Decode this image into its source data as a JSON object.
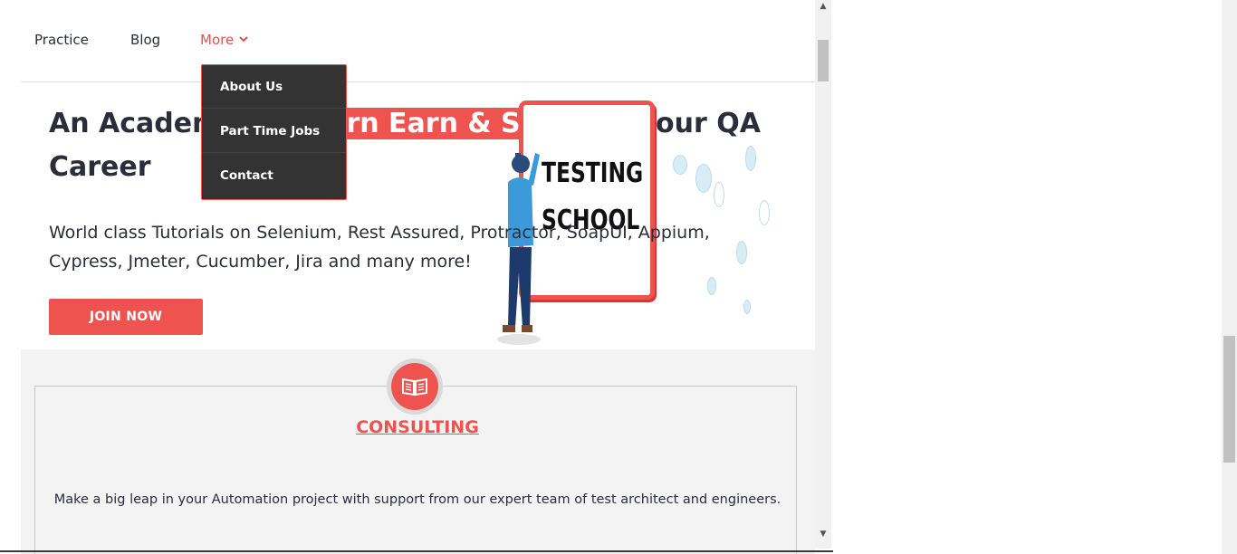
{
  "nav": {
    "items": [
      "Practice",
      "Blog",
      "More"
    ],
    "more_chevron": "⌄"
  },
  "dropdown": {
    "items": [
      "About Us",
      "Part Time Jobs",
      "Contact"
    ]
  },
  "hero": {
    "title_pre": "An Academy to ",
    "title_highlight": "Learn Earn & Shine",
    "title_post": "  in your QA Career",
    "subtitle": "World class Tutorials on Selenium, Rest Assured, Protractor, SoapUI, Appium, Cypress, Jmeter, Cucumber, Jira and many more!",
    "join_label": "JOIN NOW",
    "illustration_text_line1": "TESTING",
    "illustration_text_line2": "SCHOOL"
  },
  "services": {
    "card_title": "CONSULTING",
    "card_text": "Make a big leap in your Automation project with support from our expert team of test architect and engineers.",
    "card_icon": "book-icon"
  },
  "colors": {
    "accent": "#ef5350",
    "text": "#2b2d3a",
    "dropdown_bg": "#333333"
  }
}
